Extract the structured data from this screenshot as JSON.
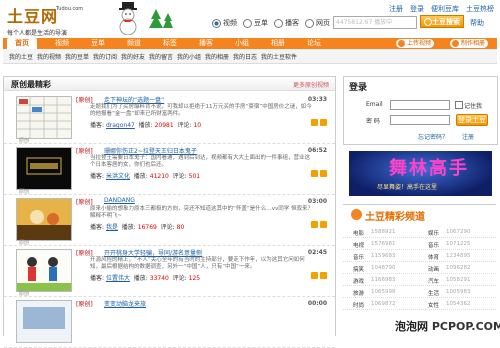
{
  "site": {
    "logo_text": "土豆网",
    "logo_url": "Tudou.com",
    "slogan": "每个人都是生活的导演"
  },
  "top_links": [
    "注册",
    "登录",
    "便利豆库",
    "土豆热榜"
  ],
  "search": {
    "options": [
      {
        "label": "视频",
        "selected": true
      },
      {
        "label": "豆单",
        "selected": false
      },
      {
        "label": "播客",
        "selected": false
      },
      {
        "label": "网页",
        "selected": false
      }
    ],
    "placeholder": "4475812.67 播放中",
    "button": "土豆搜索",
    "help": "帮助"
  },
  "nav": {
    "items": [
      "首页",
      "视频",
      "豆单",
      "频道",
      "标签",
      "播客",
      "小组",
      "相册",
      "论坛"
    ],
    "active": 0,
    "upload": "上传视频",
    "make": "制作相册"
  },
  "subnav": [
    "我的土豆",
    "我的视频",
    "我的豆单",
    "我的订阅",
    "我的好友",
    "我的留言",
    "我的小组",
    "我的相册",
    "我的日志",
    "我的土豆软件"
  ],
  "main": {
    "title": "原创最精彩",
    "more": "更多原创视频",
    "items": [
      {
        "tag": "[原创]",
        "title": "走下神坛的“选题一盘”",
        "duration": "03:33",
        "desc": "走题我们为了买房爆料背不说，可我却以拒绝于11万元买的手房“豪宿”中国房价之谜，如今的他报看“金一盘”却来已所财富两件。",
        "author": "dragon47",
        "plays": "20981",
        "comments": "10",
        "thumb": "grid",
        "thumb_label": "原创"
      },
      {
        "tag": "[原创]",
        "title": "珊娜你伤正2~拉登天王归日本鬼子",
        "duration": "06:52",
        "desc": "当拉登王需要日本鬼子：国内看通，遇到后到达，视频都有大大土面出的一件事组，营业这个日本客居的女，你们也后还。",
        "author": "米洪文化",
        "plays": "41210",
        "comments": "501",
        "thumb": "dark",
        "thumb_label": "原创"
      },
      {
        "tag": "[原创]",
        "title": "DANDANG",
        "duration": "03:00",
        "desc": "原来小偷的想象力原本三都极的方向，突还不知道这其中的“怀盖”是什么…vv同学 恒寂来？解释不明飞~",
        "author": "我是",
        "plays": "16769",
        "comments": "80",
        "thumb": "scene",
        "thumb_label": "原创"
      },
      {
        "tag": "[原创]",
        "title": "开开桃身大学轻骗，导同/游名意量侧",
        "duration": "02:45",
        "desc": "开源风险的精上，“不人”关心全年的有当时的主持部分，要走下作年，以为这其它问如何知，最后根据结构的数据调查，另外一“中国”人，只有“中国”一来。",
        "author": "位置伟大",
        "plays": "33740",
        "comments": "125",
        "thumb": "people",
        "thumb_label": "原创"
      },
      {
        "tag": "[原创]",
        "title": "变变动脑龙来旅",
        "duration": "00:00",
        "desc": "",
        "author": "",
        "plays": "",
        "comments": "",
        "thumb": "grid",
        "thumb_label": "原创"
      }
    ],
    "labels": {
      "author": "播客:",
      "plays": "播放:",
      "comments": "评论:"
    }
  },
  "login": {
    "title": "登录",
    "email_label": "Email",
    "password_label": "密 码",
    "remember": "记住我",
    "button": "登录土豆",
    "forgot": "忘记密码？",
    "register": "注册"
  },
  "banner": {
    "big": "舞林高手",
    "sub": "尽显舞姿！高手在这里"
  },
  "channel": {
    "title": "土豆精彩频道",
    "rows": [
      [
        "电影",
        "1588921",
        "娱乐",
        "1067290"
      ],
      [
        "电视",
        "1576981",
        "音乐",
        "1071225"
      ],
      [
        "音乐",
        "1159683",
        "体育",
        "1234895"
      ],
      [
        "搞笑",
        "1048790",
        "动画",
        "1096282"
      ],
      [
        "游戏",
        "1166983",
        "汽车",
        "1058291"
      ],
      [
        "旅游",
        "1065998",
        "生活",
        "1005983"
      ],
      [
        "时尚",
        "1069872",
        "女性",
        "1054362"
      ]
    ]
  },
  "watermark": {
    "cn": "泡泡网",
    "en": "PCPOP.COM"
  },
  "colors": {
    "accent": "#f5841f",
    "link": "#1b5fa6"
  }
}
